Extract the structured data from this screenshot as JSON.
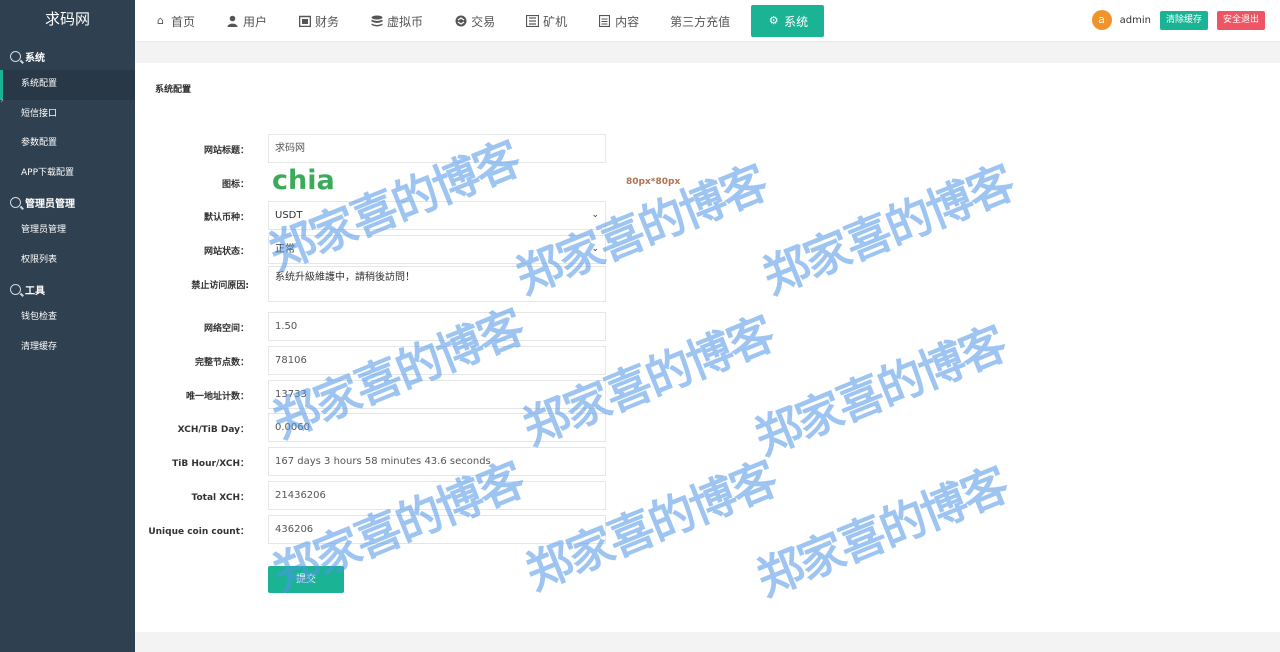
{
  "brand": "求码网",
  "sidebar": {
    "groups": [
      {
        "label": "系统",
        "items": [
          "系统配置",
          "短信接口",
          "参数配置",
          "APP下载配置"
        ]
      },
      {
        "label": "管理员管理",
        "items": [
          "管理员管理",
          "权限列表"
        ]
      },
      {
        "label": "工具",
        "items": [
          "钱包检查",
          "清理缓存"
        ]
      }
    ]
  },
  "nav": {
    "items": [
      {
        "label": "首页",
        "icon": "home-icon"
      },
      {
        "label": "用户",
        "icon": "user-icon"
      },
      {
        "label": "财务",
        "icon": "finance-icon"
      },
      {
        "label": "虚拟币",
        "icon": "database-icon"
      },
      {
        "label": "交易",
        "icon": "exchange-icon"
      },
      {
        "label": "矿机",
        "icon": "miner-icon"
      },
      {
        "label": "内容",
        "icon": "content-icon"
      },
      {
        "label": "第三方充值",
        "icon": ""
      },
      {
        "label": "系统",
        "icon": "gear-icon"
      }
    ],
    "user": {
      "avatar_letter": "a",
      "name": "admin",
      "clear_cache": "清除缓存",
      "logout": "安全退出"
    }
  },
  "page": {
    "title": "系统配置",
    "fields": {
      "site_title_label": "网站标题：",
      "site_title_value": "求码网",
      "logo_label": "图标：",
      "logo_text": "chia",
      "logo_hint": "80px*80px",
      "currency_label": "默认币种：",
      "currency_value": "USDT",
      "status_label": "网站状态：",
      "status_value": "正常",
      "ban_reason_label": "禁止访问原因:",
      "ban_reason_value": "系统升級維護中，請稍後訪問！",
      "net_space_label": "网络空间：",
      "net_space_value": "1.50",
      "full_nodes_label": "完整节点数：",
      "full_nodes_value": "78106",
      "unique_addr_label": "唯一地址计数：",
      "unique_addr_value": "13733",
      "xch_tib_label": "XCH/TiB Day：",
      "xch_tib_value": "0.0060",
      "tib_hour_label": "TiB Hour/XCH：",
      "tib_hour_value": "167 days 3 hours 58 minutes 43.6 seconds",
      "total_xch_label": "Total XCH：",
      "total_xch_value": "21436206",
      "unique_coin_label": "Unique coin count：",
      "unique_coin_value": "436206"
    },
    "submit": "提交"
  },
  "watermark": "郑家喜的博客",
  "colors": {
    "accent": "#1ab394",
    "danger": "#ed5565",
    "sidebar": "#2f4050",
    "avatar": "#f0932b",
    "logo": "#3aac59"
  }
}
